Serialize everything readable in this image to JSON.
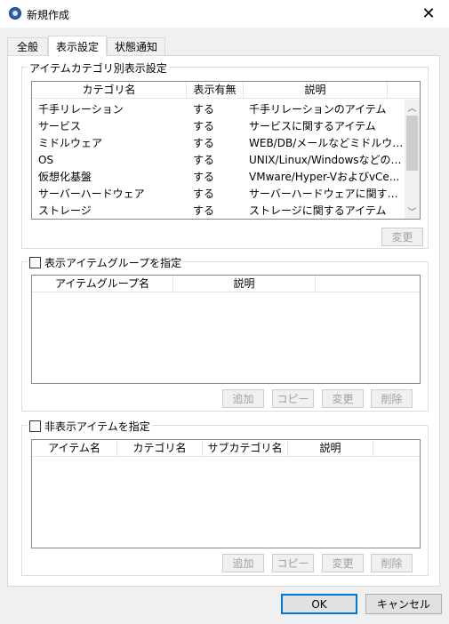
{
  "window": {
    "title": "新規作成",
    "close_glyph": "✕"
  },
  "tabs": [
    {
      "label": "全般"
    },
    {
      "label": "表示設定"
    },
    {
      "label": "状態通知"
    }
  ],
  "category_group": {
    "legend": "アイテムカテゴリ別表示設定",
    "columns": [
      "カテゴリ名",
      "表示有無",
      "説明"
    ],
    "rows": [
      [
        "千手リレーション",
        "する",
        "千手リレーションのアイテム"
      ],
      [
        "サービス",
        "する",
        "サービスに関するアイテム"
      ],
      [
        "ミドルウェア",
        "する",
        "WEB/DB/メールなどミドルウェア..."
      ],
      [
        "OS",
        "する",
        "UNIX/Linux/WindowsなどのO..."
      ],
      [
        "仮想化基盤",
        "する",
        "VMware/Hyper-VおよびvCe..."
      ],
      [
        "サーバーハードウェア",
        "する",
        "サーバーハードウェアに関するアイ..."
      ],
      [
        "ストレージ",
        "する",
        "ストレージに関するアイテム"
      ]
    ],
    "change_label": "変更"
  },
  "item_group_section": {
    "legend": "表示アイテムグループを指定",
    "columns": [
      "アイテムグループ名",
      "説明"
    ],
    "buttons": [
      "追加",
      "コピー",
      "変更",
      "削除"
    ]
  },
  "hidden_item_section": {
    "legend": "非表示アイテムを指定",
    "columns": [
      "アイテム名",
      "カテゴリ名",
      "サブカテゴリ名",
      "説明"
    ],
    "buttons": [
      "追加",
      "コピー",
      "変更",
      "削除"
    ]
  },
  "footer": {
    "ok_label": "OK",
    "cancel_label": "キャンセル"
  }
}
